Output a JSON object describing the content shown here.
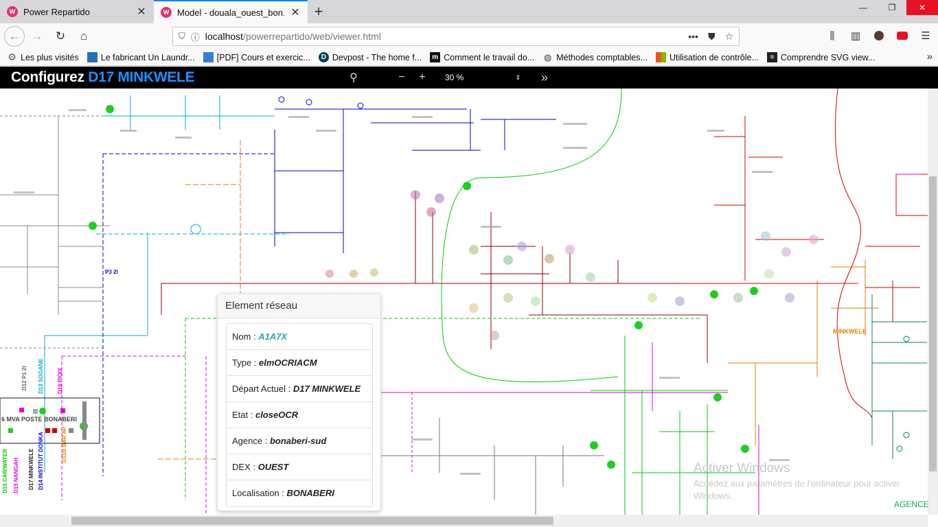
{
  "browser": {
    "tabs": [
      {
        "title": "Power Repartido",
        "icon": "app-icon",
        "active": false
      },
      {
        "title": "Model - douala_ouest_bon.pdf",
        "icon": "app-icon",
        "active": true
      }
    ],
    "new_tab_label": "+",
    "window_controls": {
      "minimize": "—",
      "maximize": "❐",
      "close": "✕"
    },
    "url": {
      "host": "localhost",
      "path": "/powerrepartido/web/viewer.html"
    },
    "bookmarks": [
      {
        "label": "Les plus visités",
        "icon": "gear-icon",
        "color": "#555555"
      },
      {
        "label": "Le fabricant Un Laundr...",
        "icon": "site-icon",
        "color": "#2a6fb5"
      },
      {
        "label": "[PDF] Cours et exercic...",
        "icon": "pdf-icon",
        "color": "#3a7bd5"
      },
      {
        "label": "Devpost - The home f...",
        "icon": "devpost-icon",
        "color": "#003e54"
      },
      {
        "label": "Comment le travail do...",
        "icon": "medium-icon",
        "color": "#111111"
      },
      {
        "label": "Méthodes comptables...",
        "icon": "globe-icon",
        "color": "#444444"
      },
      {
        "label": "Utilisation de contrôle...",
        "icon": "microsoft-icon",
        "color": "#f25022"
      },
      {
        "label": "Comprendre SVG view...",
        "icon": "doc-icon",
        "color": "#222222"
      }
    ]
  },
  "viewer": {
    "title_prefix": "Configurez",
    "title_accent": "D17 MINKWELE",
    "zoom": "30 %",
    "accent_color": "#1e90ff"
  },
  "popup": {
    "title": "Element réseau",
    "rows": [
      {
        "label": "Nom : ",
        "value": "A1A7X"
      },
      {
        "label": "Type : ",
        "value": "elmOCRIACM"
      },
      {
        "label": "Départ Actuel : ",
        "value": "D17 MINKWELE"
      },
      {
        "label": "Etat : ",
        "value": "closeOCR"
      },
      {
        "label": "Agence : ",
        "value": "bonaberi-sud"
      },
      {
        "label": "DEX : ",
        "value": "OUEST"
      },
      {
        "label": "Localisation : ",
        "value": "BONABERI"
      }
    ]
  },
  "diagram": {
    "labels": {
      "poste": "6 MVA POSTE BONABERI",
      "minkwele": "MINKWELE",
      "lignes": [
        "D12 P1 2I",
        "D13 SOGANE",
        "D16 PIOIX",
        "D15 NANGAH",
        "D17 MINKWELE",
        "D14 INSTITUT DONKA",
        "D15 CARIWATER",
        "D11B BAR AP"
      ],
      "p3": "P3 2I",
      "agence_label": "AGENCE"
    },
    "colors": {
      "red": "#cc0000",
      "darkred": "#8b0000",
      "blue": "#0000cc",
      "cyan": "#00a8e0",
      "green": "#00cc00",
      "magenta": "#e000e0",
      "orange": "#e67e00",
      "teal": "#008855",
      "gray": "#777777"
    }
  },
  "windows_watermark": {
    "title": "Activer Windows",
    "subtitle": "Accédez aux paramètres de l'ordinateur pour activer Windows."
  }
}
